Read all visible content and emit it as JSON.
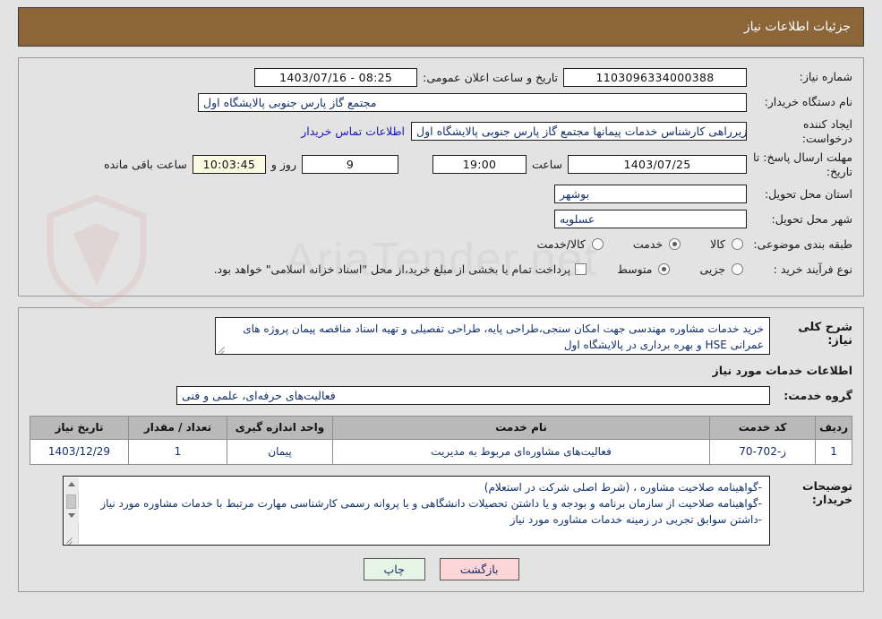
{
  "header": {
    "title": "جزئیات اطلاعات نیاز"
  },
  "top": {
    "need_number_label": "شماره نیاز:",
    "need_number": "1103096334000388",
    "public_announce_label": "تاریخ و ساعت اعلان عمومی:",
    "public_announce": "08:25 - 1403/07/16",
    "buyer_org_label": "نام دستگاه خریدار:",
    "buyer_org": "مجتمع گاز پارس جنوبی  پالایشگاه اول",
    "creator_label": "ایجاد کننده درخواست:",
    "creator": "ولی اله زیرراهی کارشناس خدمات پیمانها مجتمع گاز پارس جنوبی  پالایشگاه اول",
    "contact_link": "اطلاعات تماس خریدار",
    "deadline_label": "مهلت ارسال پاسخ: تا تاریخ:",
    "deadline_date": "1403/07/25",
    "hour_label": "ساعت",
    "deadline_time": "19:00",
    "days_value": "9",
    "days_label": "روز و",
    "countdown": "10:03:45",
    "remaining_label": "ساعت باقی مانده",
    "province_label": "استان محل تحویل:",
    "province": "بوشهر",
    "city_label": "شهر محل تحویل:",
    "city": "عسلویه",
    "category_label": "طبقه بندی موضوعی:",
    "category_options": [
      {
        "label": "کالا",
        "selected": false
      },
      {
        "label": "خدمت",
        "selected": true
      },
      {
        "label": "کالا/خدمت",
        "selected": false
      }
    ],
    "process_label": "نوع فرآیند خرید :",
    "process_options": [
      {
        "label": "جزیی",
        "selected": false
      },
      {
        "label": "متوسط",
        "selected": true
      }
    ],
    "treasury_checkbox_checked": false,
    "treasury_note": "پرداخت تمام یا بخشی از مبلغ خرید،از محل \"اسناد خزانه اسلامی\" خواهد بود."
  },
  "description": {
    "label": "شرح کلی نیاز:",
    "text": "خرید خدمات مشاوره مهندسی جهت امکان سنجی،طراحی پایه، طراحی تفصیلی و تهیه اسناد مناقصه پیمان پروژه های عمرانی HSE و بهره برداری در پالایشگاه اول"
  },
  "services": {
    "section_title": "اطلاعات خدمات مورد نیاز",
    "group_label": "گروه خدمت:",
    "group_value": "فعالیت‌های حرفه‌ای، علمی و فنی",
    "table": {
      "headers": [
        "ردیف",
        "کد خدمت",
        "نام خدمت",
        "واحد اندازه گیری",
        "تعداد / مقدار",
        "تاریخ نیاز"
      ],
      "rows": [
        {
          "radif": "1",
          "code": "ز-702-70",
          "name": "فعالیت‌های مشاوره‌ای مربوط به مدیریت",
          "unit": "پیمان",
          "qty": "1",
          "date": "1403/12/29"
        }
      ]
    }
  },
  "buyer_notes": {
    "label": "توضیحات خریدار:",
    "lines": [
      "-گواهینامه صلاحیت مشاوره ، (شرط اصلی شرکت در استعلام)",
      "-گواهینامه صلاحیت از سازمان برنامه و بودجه و یا داشتن تحصیلات دانشگاهی و یا پروانه رسمی کارشناسی مهارت مرتبط با خدمات مشاوره مورد نیاز",
      "-داشتن سوابق تجربی در زمینه خدمات مشاوره مورد نیاز"
    ]
  },
  "footer": {
    "print_label": "چاپ",
    "return_label": "بازگشت"
  },
  "watermark": {
    "text": "AriaTender.net"
  },
  "colors": {
    "header_bar": "#8c6639",
    "page_bg": "#e3e3e3",
    "field_text": "#14306b",
    "link": "#1818b8",
    "table_header": "#b9b9b9",
    "timer_bg": "#fbfbe2",
    "print_btn": "#e6f5e6",
    "return_btn": "#fcd6d6"
  }
}
